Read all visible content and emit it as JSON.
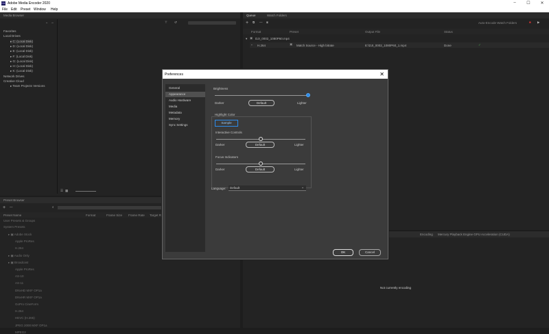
{
  "app": {
    "title": "Adobe Media Encoder 2020",
    "logo": "Me"
  },
  "window_controls": {
    "minimize": "–",
    "maximize": "☐",
    "close": "✕"
  },
  "menu": [
    "File",
    "Edit",
    "Preset",
    "Window",
    "Help"
  ],
  "media_browser": {
    "tab": "Media Browser",
    "sections": [
      {
        "label": "Favorites",
        "indent": 0
      },
      {
        "label": "Local Drives",
        "indent": 0
      },
      {
        "label": "C: (Local Disk)",
        "indent": 1
      },
      {
        "label": "D: (Local Disk)",
        "indent": 1
      },
      {
        "label": "E: (Local Disk)",
        "indent": 1
      },
      {
        "label": "F: (Local Disk)",
        "indent": 1
      },
      {
        "label": "G: (Local Disk)",
        "indent": 1
      },
      {
        "label": "H: (Local Disk)",
        "indent": 1
      },
      {
        "label": "K: (Local Disk)",
        "indent": 1
      },
      {
        "label": "Network Drives",
        "indent": 0
      },
      {
        "label": "Creative Cloud",
        "indent": 0
      },
      {
        "label": "Team Projects Versions",
        "indent": 1
      }
    ]
  },
  "queue": {
    "tabs": [
      "Queue",
      "Watch Folders"
    ],
    "auto_encode": "Auto-Encode Watch Folders",
    "columns": [
      "Format",
      "Preset",
      "Output File",
      "Status"
    ],
    "item": {
      "name": "DJI_0002_1080P60.mp4"
    },
    "row": {
      "format": "H.264",
      "preset": "Match Source - High bitrate",
      "output": "E:\\DJI_0002_1080P60_1.mp4",
      "status": "Done",
      "status_mark": "✓"
    }
  },
  "preset_browser": {
    "tab": "Preset Browser",
    "columns": [
      "Preset Name",
      "Format",
      "Frame Size",
      "Frame Rate",
      "Target R"
    ],
    "groups": [
      "User Presets & Groups",
      "System Presets"
    ],
    "items": [
      {
        "label": "Adobe Stock",
        "level": 1
      },
      {
        "label": "Apple ProRes",
        "level": 2
      },
      {
        "label": "H.264",
        "level": 2
      },
      {
        "label": "Audio Only",
        "level": 1
      },
      {
        "label": "Broadcast",
        "level": 1
      },
      {
        "label": "Apple ProRes",
        "level": 2
      },
      {
        "label": "AS-10",
        "level": 2
      },
      {
        "label": "AS-11",
        "level": 2
      },
      {
        "label": "DNxHD MXF OP1a",
        "level": 2
      },
      {
        "label": "DNxHR MXF OP1a",
        "level": 2
      },
      {
        "label": "GoPro CineForm",
        "level": 2
      },
      {
        "label": "H.264",
        "level": 2
      },
      {
        "label": "HEVC (H.265)",
        "level": 2
      },
      {
        "label": "JPEG 2000 MXF OP1a",
        "level": 2
      },
      {
        "label": "MPEG2",
        "level": 2
      }
    ]
  },
  "encoding": {
    "tabs": [
      "Encoding",
      "Mercury Playback Engine GPU Acceleration (CUDA)"
    ],
    "status": "Not currently encoding"
  },
  "preferences": {
    "title": "Preferences",
    "close": "✕",
    "nav": [
      "General",
      "Appearance",
      "Audio Hardware",
      "Media",
      "Metadata",
      "Memory",
      "Sync Settings"
    ],
    "selected": "Appearance",
    "brightness": {
      "label": "Brightness",
      "darker": "Darker",
      "lighter": "Lighter",
      "default": "Default",
      "value": 1.0
    },
    "highlight": {
      "label": "Highlight Color",
      "sample": "Sample"
    },
    "interactive": {
      "label": "Interactive Controls",
      "darker": "Darker",
      "lighter": "Lighter",
      "default": "Default",
      "value": 0.5
    },
    "focus": {
      "label": "Focus Indicators",
      "darker": "Darker",
      "lighter": "Lighter",
      "default": "Default",
      "value": 0.5
    },
    "language": {
      "label": "Language:",
      "value": "Default"
    },
    "ok": "OK",
    "cancel": "Cancel"
  },
  "colors": {
    "accent": "#2d8ceb",
    "background": "#1d1d1d",
    "panel": "#232323",
    "dialog": "#3b3b3b"
  }
}
